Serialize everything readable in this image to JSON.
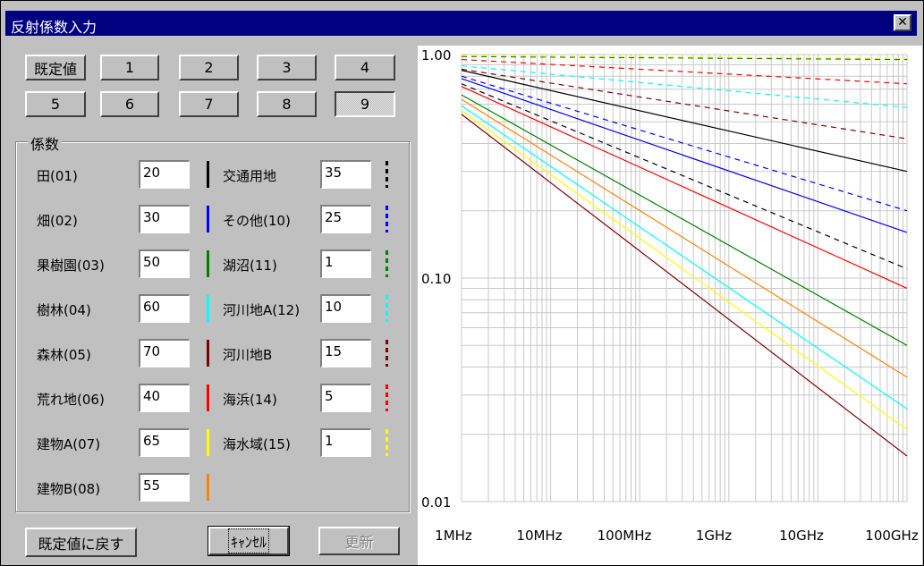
{
  "window": {
    "title": "反射係数入力",
    "close_label": "✕"
  },
  "preset_buttons": [
    "既定値",
    "1",
    "2",
    "3",
    "4",
    "5",
    "6",
    "7",
    "8",
    "9"
  ],
  "selected_preset": "9",
  "group_title": "係数",
  "left_items": [
    {
      "label": "田(01)",
      "value": "20",
      "color": "#000000",
      "dashed": false
    },
    {
      "label": "畑(02)",
      "value": "30",
      "color": "#0000ff",
      "dashed": false
    },
    {
      "label": "果樹園(03)",
      "value": "50",
      "color": "#008000",
      "dashed": false
    },
    {
      "label": "樹林(04)",
      "value": "60",
      "color": "#00ffff",
      "dashed": false
    },
    {
      "label": "森林(05)",
      "value": "70",
      "color": "#800000",
      "dashed": false
    },
    {
      "label": "荒れ地(06)",
      "value": "40",
      "color": "#ff0000",
      "dashed": false
    },
    {
      "label": "建物A(07)",
      "value": "65",
      "color": "#ffff00",
      "dashed": false
    },
    {
      "label": "建物B(08)",
      "value": "55",
      "color": "#ff8000",
      "dashed": false
    }
  ],
  "right_items": [
    {
      "label": "交通用地",
      "value": "35",
      "color": "#000000",
      "dashed": true
    },
    {
      "label": "その他(10)",
      "value": "25",
      "color": "#0000ff",
      "dashed": true
    },
    {
      "label": "湖沼(11)",
      "value": "1",
      "color": "#008000",
      "dashed": true
    },
    {
      "label": "河川地A(12)",
      "value": "10",
      "color": "#00ffff",
      "dashed": true
    },
    {
      "label": "河川地B",
      "value": "15",
      "color": "#800000",
      "dashed": true
    },
    {
      "label": "海浜(14)",
      "value": "5",
      "color": "#ff0000",
      "dashed": true
    },
    {
      "label": "海水域(15)",
      "value": "1",
      "color": "#ffff00",
      "dashed": true
    }
  ],
  "footer": {
    "reset_label": "既定値に戻す",
    "cancel_label": "ｷｬﾝｾﾙ",
    "update_label": "更新"
  },
  "chart_data": {
    "type": "line",
    "x_scale": "log",
    "y_scale": "log",
    "xlim": [
      "1MHz",
      "100GHz"
    ],
    "ylim": [
      0.01,
      1.0
    ],
    "x_ticks": [
      "1MHz",
      "10MHz",
      "100MHz",
      "1GHz",
      "10GHz",
      "100GHz"
    ],
    "y_ticks": [
      "1.00",
      "0.10",
      "0.01"
    ],
    "grid": true,
    "series": [
      {
        "color": "#000000",
        "dashed": false,
        "y_at_1MHz": 0.85,
        "y_at_100GHz": 0.3
      },
      {
        "color": "#0000ff",
        "dashed": false,
        "y_at_1MHz": 0.78,
        "y_at_100GHz": 0.16
      },
      {
        "color": "#008000",
        "dashed": false,
        "y_at_1MHz": 0.66,
        "y_at_100GHz": 0.05
      },
      {
        "color": "#00ffff",
        "dashed": false,
        "y_at_1MHz": 0.59,
        "y_at_100GHz": 0.026
      },
      {
        "color": "#800000",
        "dashed": false,
        "y_at_1MHz": 0.54,
        "y_at_100GHz": 0.016
      },
      {
        "color": "#ff0000",
        "dashed": false,
        "y_at_1MHz": 0.72,
        "y_at_100GHz": 0.09
      },
      {
        "color": "#ffff00",
        "dashed": false,
        "y_at_1MHz": 0.56,
        "y_at_100GHz": 0.021
      },
      {
        "color": "#ff8000",
        "dashed": false,
        "y_at_1MHz": 0.63,
        "y_at_100GHz": 0.036
      },
      {
        "color": "#000000",
        "dashed": true,
        "y_at_1MHz": 0.74,
        "y_at_100GHz": 0.11
      },
      {
        "color": "#0000ff",
        "dashed": true,
        "y_at_1MHz": 0.8,
        "y_at_100GHz": 0.2
      },
      {
        "color": "#008000",
        "dashed": true,
        "y_at_1MHz": 0.98,
        "y_at_100GHz": 0.95
      },
      {
        "color": "#00ffff",
        "dashed": true,
        "y_at_1MHz": 0.89,
        "y_at_100GHz": 0.58
      },
      {
        "color": "#800000",
        "dashed": true,
        "y_at_1MHz": 0.86,
        "y_at_100GHz": 0.42
      },
      {
        "color": "#ff0000",
        "dashed": true,
        "y_at_1MHz": 0.95,
        "y_at_100GHz": 0.74
      },
      {
        "color": "#ffff00",
        "dashed": true,
        "y_at_1MHz": 0.99,
        "y_at_100GHz": 0.96
      }
    ]
  }
}
